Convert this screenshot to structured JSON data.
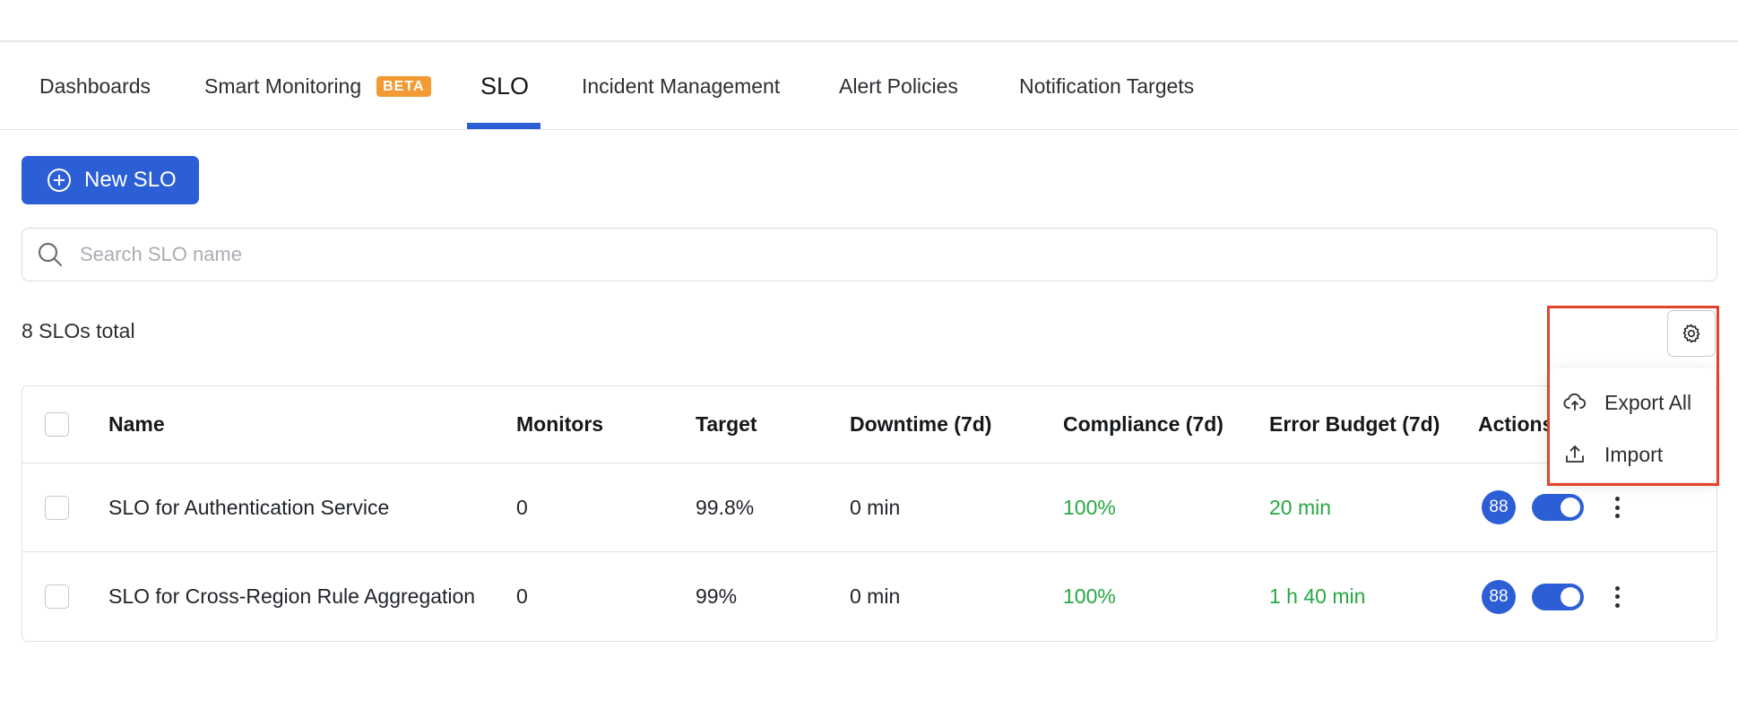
{
  "tabs": [
    {
      "label": "Dashboards"
    },
    {
      "label": "Smart Monitoring",
      "badge": "BETA"
    },
    {
      "label": "SLO",
      "active": true
    },
    {
      "label": "Incident Management"
    },
    {
      "label": "Alert Policies"
    },
    {
      "label": "Notification Targets"
    }
  ],
  "new_button": {
    "label": "New SLO",
    "icon": "plus-circle-icon"
  },
  "search": {
    "placeholder": "Search SLO name",
    "value": ""
  },
  "total_label": "8 SLOs total",
  "table": {
    "columns": [
      "Name",
      "Monitors",
      "Target",
      "Downtime (7d)",
      "Compliance (7d)",
      "Error Budget (7d)",
      "Actions"
    ],
    "rows": [
      {
        "name": "SLO for Authentication Service",
        "monitors": "0",
        "target": "99.8%",
        "downtime": "0 min",
        "compliance": "100%",
        "error_budget": "20 min",
        "badge": "88",
        "enabled": true
      },
      {
        "name": "SLO for Cross-Region Rule Aggregation",
        "monitors": "0",
        "target": "99%",
        "downtime": "0 min",
        "compliance": "100%",
        "error_budget": "1 h 40 min",
        "badge": "88",
        "enabled": true
      }
    ]
  },
  "settings_menu": {
    "button_icon": "gear-icon",
    "items": [
      {
        "label": "Export All",
        "icon": "cloud-upload-icon"
      },
      {
        "label": "Import",
        "icon": "upload-icon"
      }
    ]
  },
  "colors": {
    "accent": "#2c5ed6",
    "success": "#27a844",
    "beta": "#f29a33",
    "highlight": "#e2432a"
  }
}
